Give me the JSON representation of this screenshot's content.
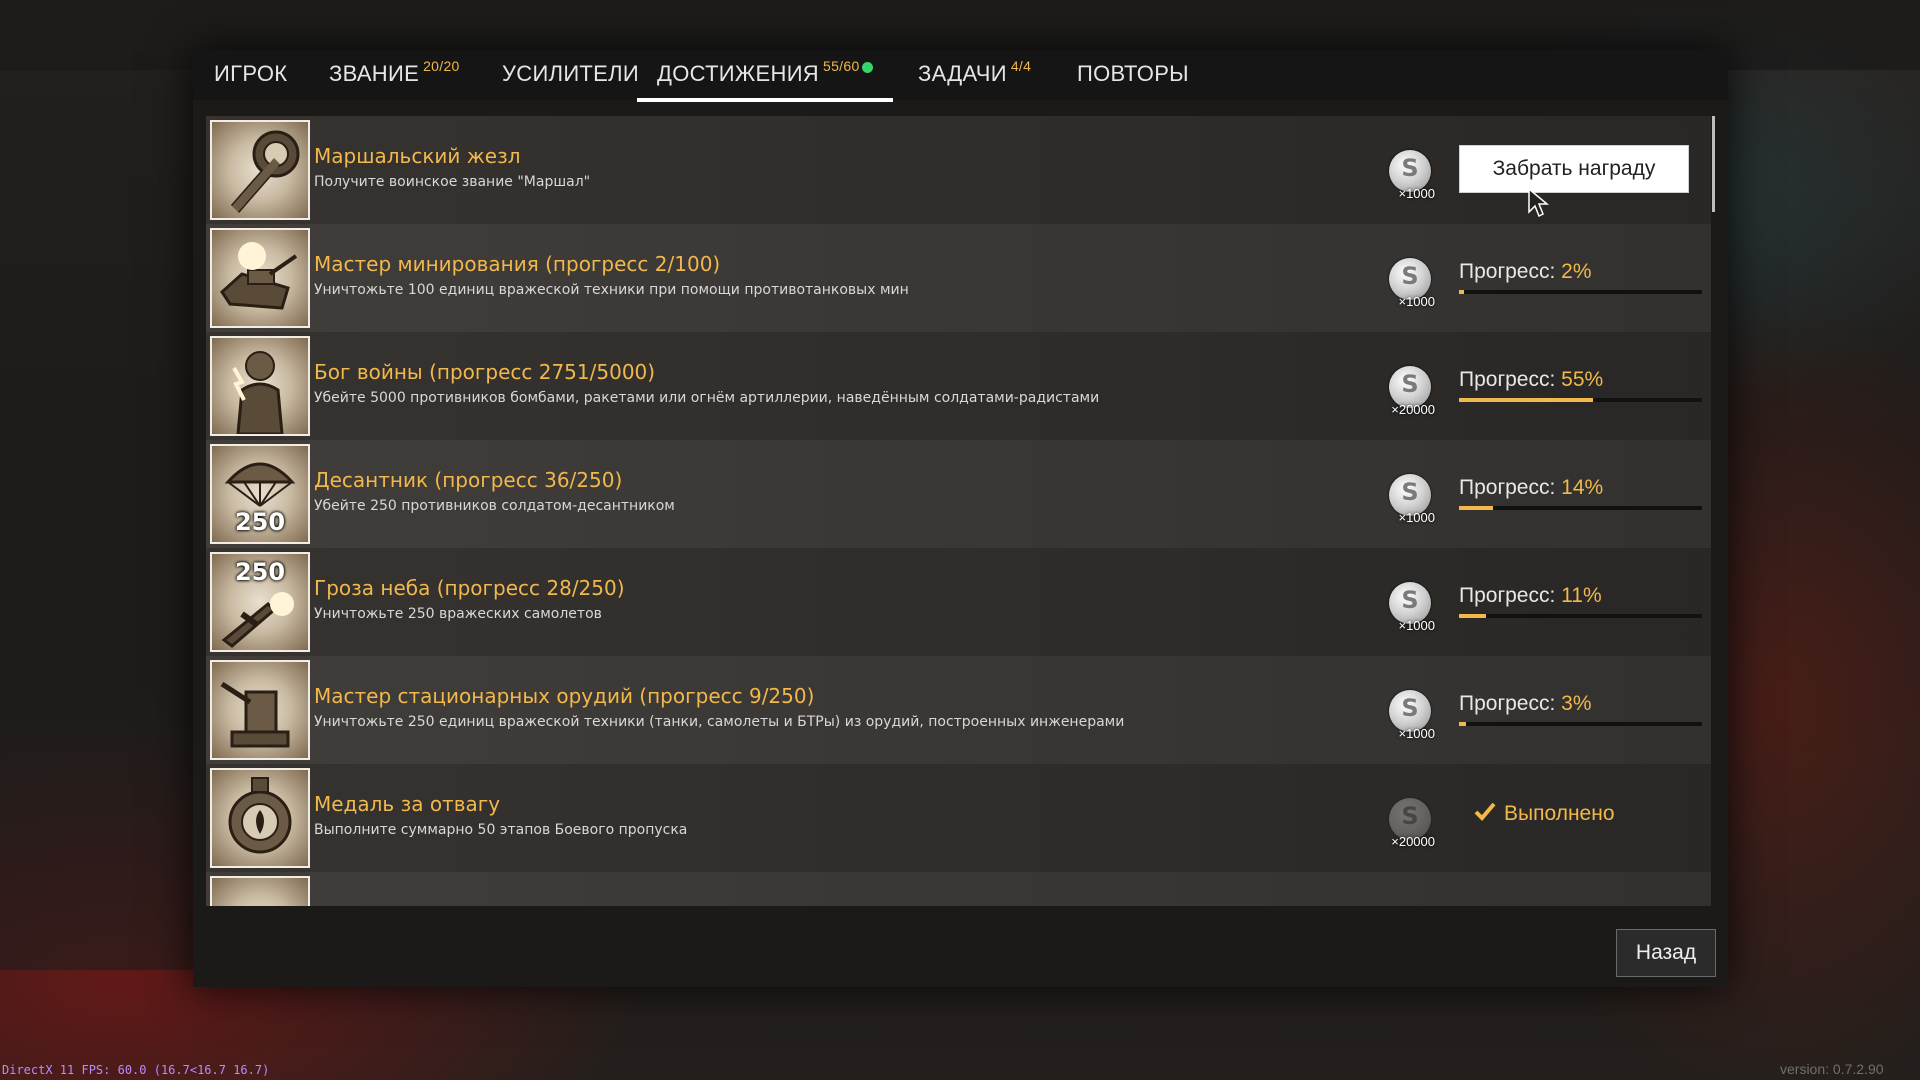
{
  "tabs": [
    {
      "label": "ИГРОК",
      "count": ""
    },
    {
      "label": "ЗВАНИЕ",
      "count": "20/20"
    },
    {
      "label": "УСИЛИТЕЛИ",
      "count": ""
    },
    {
      "label": "ДОСТИЖЕНИЯ",
      "count": "55/60",
      "active": true
    },
    {
      "label": "ЗАДАЧИ",
      "count": "4/4"
    },
    {
      "label": "ПОВТОРЫ",
      "count": ""
    }
  ],
  "achievements": [
    {
      "title": "Маршальский жезл",
      "desc": "Получите воинское звание \"Маршал\"",
      "reward": "×1000",
      "state": "claim",
      "action_label": "Забрать награду",
      "icon": "marshal-baton-icon"
    },
    {
      "title": "Мастер минирования (прогресс 2/100)",
      "desc": "Уничтожьте 100 единиц вражеской техники при помощи противотанковых мин",
      "reward": "×1000",
      "state": "progress",
      "progress_label": "Прогресс: ",
      "progress_pct": "2%",
      "progress_value": 0.02,
      "icon": "mine-tank-icon"
    },
    {
      "title": "Бог войны (прогресс 2751/5000)",
      "desc": "Убейте 5000 противников бомбами, ракетами или огнём артиллерии, наведённым солдатами-радистами",
      "reward": "×20000",
      "state": "progress",
      "progress_label": "Прогресс: ",
      "progress_pct": "55%",
      "progress_value": 0.55,
      "icon": "zeus-icon"
    },
    {
      "title": "Десантник (прогресс 36/250)",
      "desc": "Убейте 250 противников солдатом-десантником",
      "reward": "×1000",
      "state": "progress",
      "progress_label": "Прогресс: ",
      "progress_pct": "14%",
      "progress_value": 0.14,
      "icon": "parachute-icon",
      "badge_number": "250"
    },
    {
      "title": "Гроза неба (прогресс 28/250)",
      "desc": "Уничтожьте 250 вражеских самолетов",
      "reward": "×1000",
      "state": "progress",
      "progress_label": "Прогресс: ",
      "progress_pct": "11%",
      "progress_value": 0.11,
      "icon": "burning-plane-icon",
      "badge_number": "250"
    },
    {
      "title": "Мастер стационарных орудий (прогресс 9/250)",
      "desc": "Уничтожьте 250 единиц вражеской техники (танки, самолеты и БТРы) из орудий, построенных инженерами",
      "reward": "×1000",
      "state": "progress",
      "progress_label": "Прогресс: ",
      "progress_pct": "3%",
      "progress_value": 0.03,
      "icon": "stationary-gun-icon"
    },
    {
      "title": "Медаль за отвагу",
      "desc": "Выполните суммарно 50 этапов Боевого пропуска",
      "reward": "×20000",
      "state": "done",
      "done_label": "Выполнено",
      "icon": "medal-icon"
    }
  ],
  "back_label": "Назад",
  "fps_text": "DirectX 11 FPS: 60.0 (16.7<16.7 16.7)",
  "version_text": "version: 0.7.2.90",
  "colors": {
    "accent": "#f2b84b",
    "notification": "#36d46a"
  }
}
